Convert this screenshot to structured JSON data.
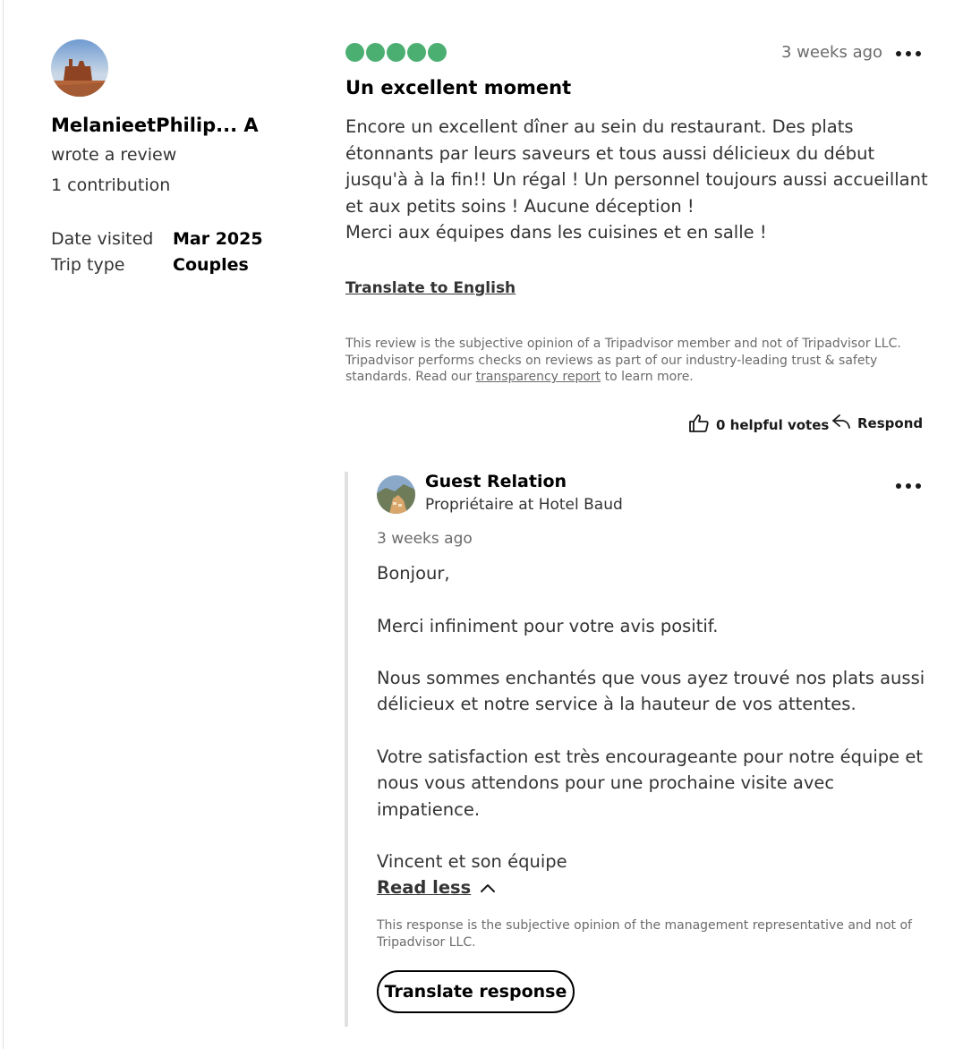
{
  "reviewer": {
    "name": "MelanieetPhilip... A",
    "action": "wrote a review",
    "contributions": "1 contribution",
    "details": [
      {
        "label": "Date visited",
        "value": "Mar 2025"
      },
      {
        "label": "Trip type",
        "value": "Couples"
      }
    ]
  },
  "review": {
    "rating": 5,
    "rating_max": 5,
    "date": "3 weeks ago",
    "title": "Un excellent moment",
    "body_lines": [
      "Encore un excellent dîner au sein du restaurant. Des plats étonnants par leurs saveurs et tous aussi délicieux du début jusqu'à à la fin!! Un régal ! Un personnel toujours aussi accueillant et aux petits soins ! Aucune déception !",
      "Merci aux équipes dans les cuisines et en salle !"
    ],
    "translate_label": "Translate to English",
    "disclaimer_before": "This review is the subjective opinion of a Tripadvisor member and not of Tripadvisor LLC. Tripadvisor performs checks on reviews as part of our industry-leading trust & safety standards. Read our ",
    "disclaimer_link": "transparency report",
    "disclaimer_after": " to learn more.",
    "helpful_label": "0 helpful votes",
    "respond_label": "Respond"
  },
  "response": {
    "name": "Guest Relation",
    "role": "Propriétaire at Hotel Baud",
    "date": "3 weeks ago",
    "paragraphs": [
      "Bonjour,",
      "Merci infiniment pour votre avis positif.",
      "Nous sommes enchantés que vous ayez trouvé nos plats aussi délicieux et notre service à la hauteur de vos attentes.",
      "Votre satisfaction est très encourageante pour notre équipe et nous vous attendons pour une prochaine visite avec impatience.",
      "Vincent et son équipe"
    ],
    "read_less_label": "Read less",
    "disclaimer": "This response is the subjective opinion of the management representative and not of Tripadvisor LLC.",
    "translate_label": "Translate response"
  },
  "colors": {
    "rating_bubble": "#4caf72",
    "text_primary": "#1a1a1a",
    "text_muted": "#6b6b6b"
  }
}
